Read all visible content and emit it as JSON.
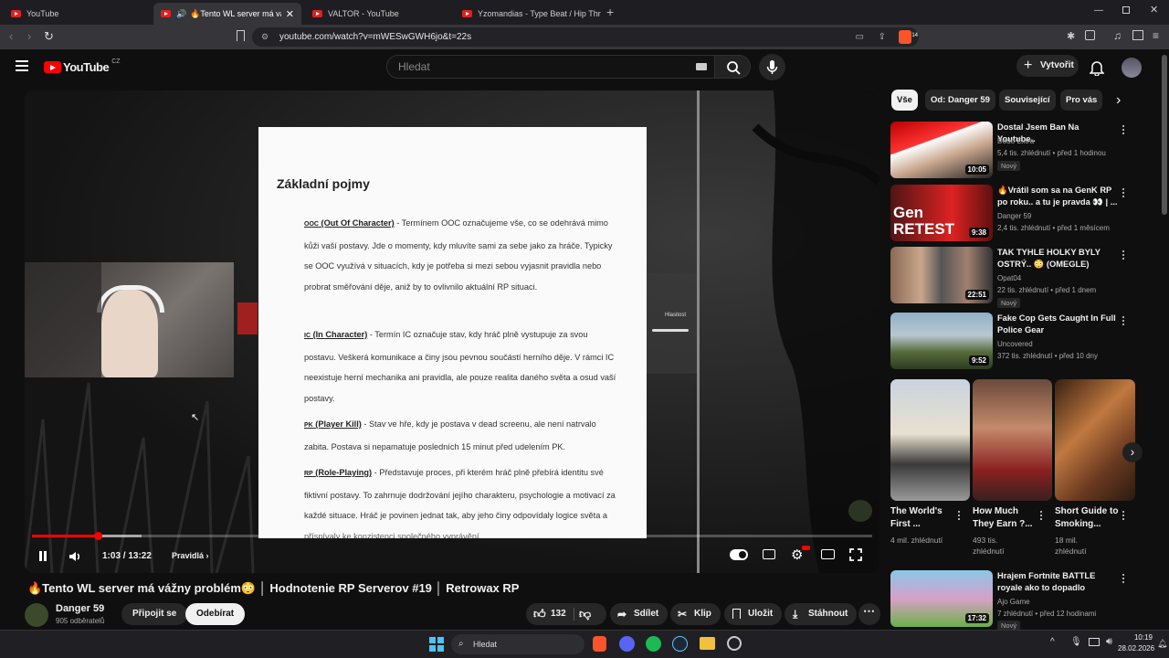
{
  "browser": {
    "tabs": [
      {
        "label": "YouTube"
      },
      {
        "label": "🔥Tento WL server má vážny"
      },
      {
        "label": "VALTOR - YouTube"
      },
      {
        "label": "Yzomandias - Type Beat / Hip Thrust"
      }
    ],
    "url": "youtube.com/watch?v=mWESwGWH6jo&t=22s",
    "brave_badge": "14"
  },
  "header": {
    "logo_text": "YouTube",
    "region": "CZ",
    "search_placeholder": "Hledat",
    "create_label": "Vytvořit"
  },
  "player": {
    "doc_title": "Základní pojmy",
    "paragraphs": [
      {
        "abbr": "OOC",
        "term": "(Out Of Character)",
        "text": " - Termínem OOC označujeme vše, co se odehrává mimo kůži vaší postavy. Jde o momenty, kdy mluvíte sami za sebe jako za hráče. Typicky se OOC využívá v situacích, kdy je potřeba si mezi sebou vyjasnit pravidla nebo probrat směřování děje, aniž by to ovlivnilo aktuální RP situaci."
      },
      {
        "abbr": "IC",
        "term": "(In Character)",
        "text": " - Termín IC označuje stav, kdy hráč plně vystupuje za svou postavu. Veškerá komunikace a činy jsou pevnou součástí herního děje. V rámci IC neexistuje herní mechanika ani pravidla, ale pouze realita daného světa a osud vaší postavy."
      },
      {
        "abbr": "PK",
        "term": "(Player Kill)",
        "text": " - Stav ve hře, kdy je postava v dead screenu, ale není natrvalo zabita. Postava si nepamatuje posledních 15 minut před udelením PK."
      },
      {
        "abbr": "RP",
        "term": "(Role-Playing)",
        "text": " - Představuje proces, při kterém hráč plně přebírá identitu své fiktivní postavy. To zahrnuje dodržování jejího charakteru, psychologie a motivací za každé situace. Hráč je povinen jednat tak, aby jeho činy odpovídaly logice světa a příspívaly ke konzistenci společného vyprávění."
      }
    ],
    "volume_label": "Hlasitost",
    "time": "1:03 / 13:22",
    "chapter": "Pravidlá",
    "progress": 0.078,
    "buffered": 0.13
  },
  "video": {
    "title": "🔥Tento WL server má vážny problém😳 │ Hodnotenie RP Serverov #19 │ Retrowax RP",
    "channel": "Danger 59",
    "subscribers": "905 odběratelů",
    "join_label": "Připojit se",
    "subscribe_label": "Odebírat",
    "likes": "132",
    "share_label": "Sdílet",
    "clip_label": "Klip",
    "save_label": "Uložit",
    "download_label": "Stáhnout"
  },
  "sidebar": {
    "chips": [
      "Vše",
      "Od: Danger 59",
      "Související",
      "Pro vás"
    ],
    "recs": [
      {
        "title": "Dostal Jsem Ban Na Youtube..",
        "channel": "Dodo Extra",
        "meta": "5,4 tis. zhlédnutí • před 1 hodinou",
        "badge": "Nový",
        "duration": "10:05"
      },
      {
        "title": "🔥Vrátil som sa na GenK RP po roku.. a tu je pravda 👀 | ...",
        "channel": "Danger 59",
        "meta": "2,4 tis. zhlédnutí • před 1 měsícem",
        "badge": "",
        "duration": "9:38",
        "thumb_text": "Gen RETEST"
      },
      {
        "title": "TAK TYHLE HOLKY BYLY OSTRÝ.. 😳 (OMEGLE)",
        "channel": "Opat04",
        "meta": "22 tis. zhlédnutí • před 1 dnem",
        "badge": "Nový",
        "duration": "22:51"
      },
      {
        "title": "Fake Cop Gets Caught In Full Police Gear",
        "channel": "Uncovered",
        "meta": "372 tis. zhlédnutí • před 10 dny",
        "badge": "",
        "duration": "9:52"
      }
    ],
    "shorts": [
      {
        "title": "The World's First ...",
        "views": "4 mil. zhlédnutí"
      },
      {
        "title": "How Much They Earn ?...",
        "views": "493 tis. zhlédnutí"
      },
      {
        "title": "Short Guide to Smoking...",
        "views": "18 mil. zhlédnutí"
      }
    ],
    "last_rec": {
      "title": "Hrajem Fortnite BATTLE royale ako to dopadlo",
      "channel": "Ajo Game",
      "meta": "7 zhlédnutí • před 12 hodinami",
      "badge": "Nový",
      "duration": "17:32"
    }
  },
  "taskbar": {
    "search_label": "Hledat",
    "time": "10:19",
    "date": "28.02.2026"
  }
}
